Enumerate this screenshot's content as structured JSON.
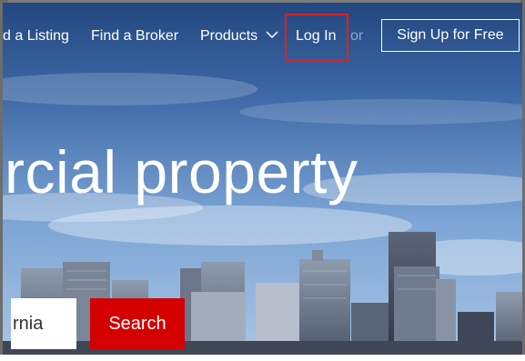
{
  "nav": {
    "add_listing": "d a Listing",
    "find_broker": "Find a Broker",
    "products": "Products",
    "log_in": "Log In",
    "or": "or",
    "sign_up": "Sign Up for Free"
  },
  "hero": {
    "headline": "rcial property"
  },
  "search": {
    "value": "rnia",
    "button_label": "Search"
  },
  "colors": {
    "accent_red": "#d40000",
    "highlight_outline": "#e02020"
  },
  "icons": {
    "products_dropdown": "chevron-down-icon"
  }
}
